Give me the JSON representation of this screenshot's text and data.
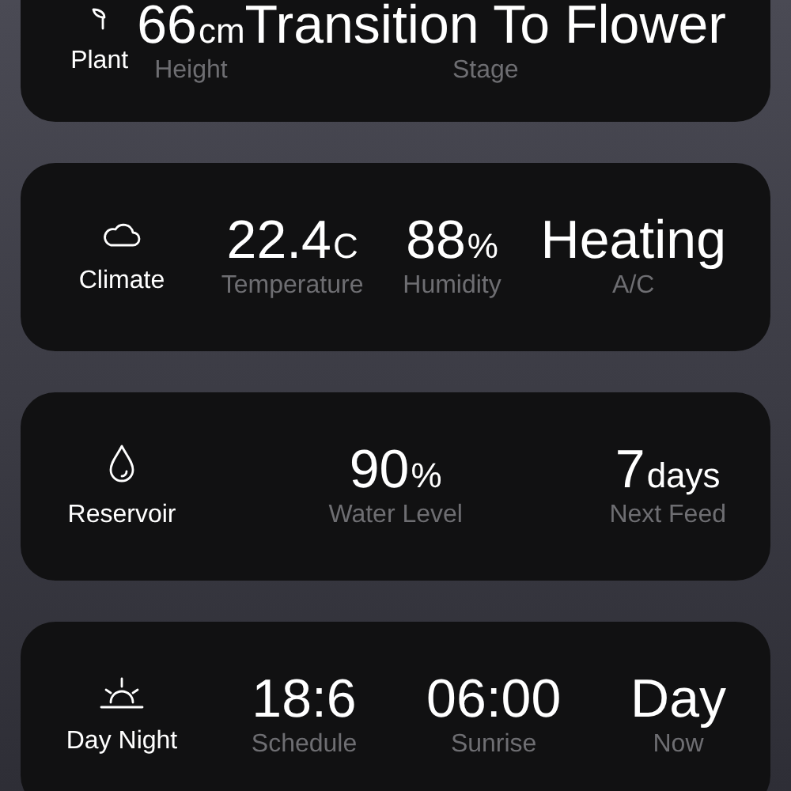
{
  "cards": [
    {
      "title": "Plant",
      "stats": [
        {
          "value": "66",
          "unit": "cm",
          "label": "Height"
        },
        {
          "value": "Transition To Flower",
          "label": "Stage"
        }
      ]
    },
    {
      "title": "Climate",
      "stats": [
        {
          "value": "22.4",
          "unit": "C",
          "label": "Temperature"
        },
        {
          "value": "88",
          "unit": "%",
          "label": "Humidity"
        },
        {
          "value": "Heating",
          "label": "A/C"
        }
      ]
    },
    {
      "title": "Reservoir",
      "stats": [
        {
          "value": "90",
          "unit": "%",
          "label": "Water Level"
        },
        {
          "value": "7",
          "unit": "days",
          "label": "Next Feed"
        }
      ]
    },
    {
      "title": "Day Night",
      "stats": [
        {
          "value": "18:6",
          "label": "Schedule"
        },
        {
          "value": "06:00",
          "label": "Sunrise"
        },
        {
          "value": "Day",
          "label": "Now"
        }
      ]
    }
  ]
}
